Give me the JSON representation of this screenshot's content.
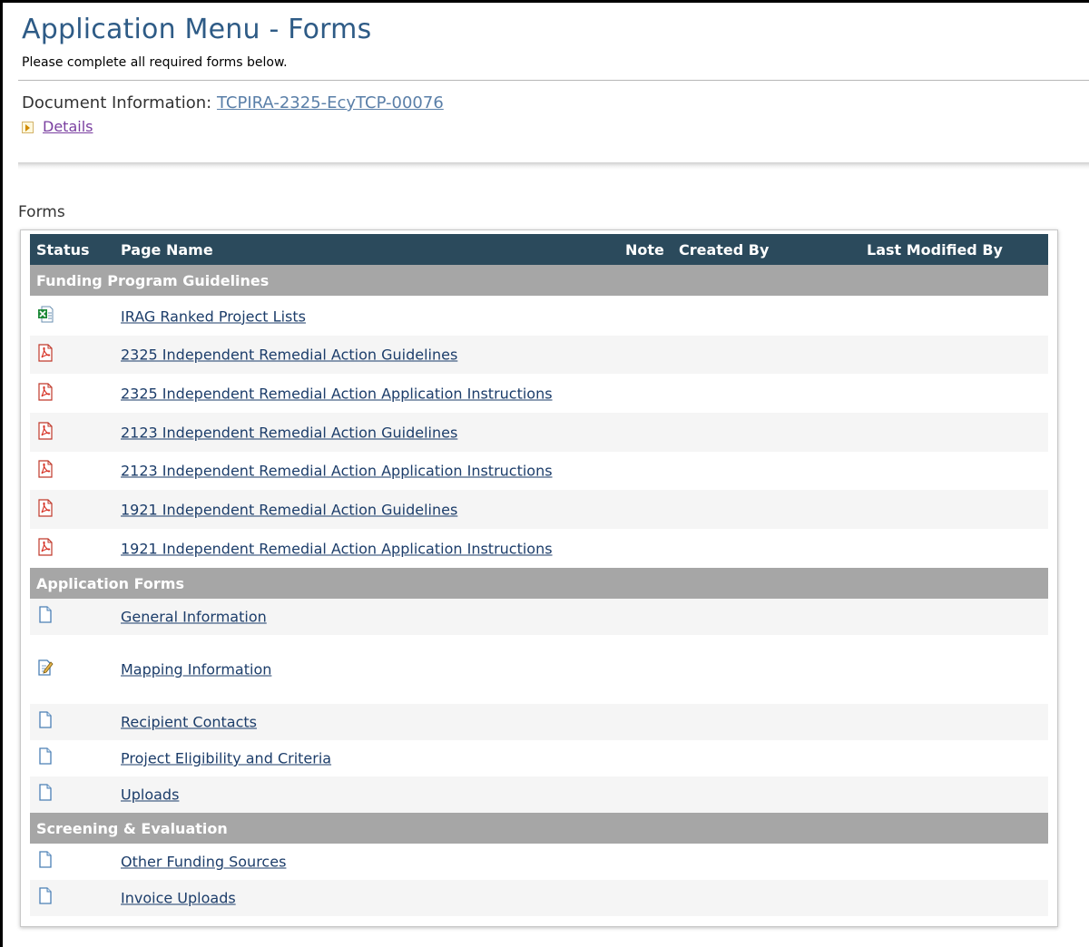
{
  "page": {
    "title": "Application Menu - Forms",
    "subtitle": "Please complete all required forms below.",
    "document_info_label": "Document Information:",
    "document_id": "TCPIRA-2325-EcyTCP-00076",
    "details_link": "Details",
    "forms_label": "Forms"
  },
  "table": {
    "headers": {
      "status": "Status",
      "page_name": "Page Name",
      "note": "Note",
      "created_by": "Created By",
      "last_modified_by": "Last Modified By"
    },
    "groups": {
      "funding": "Funding Program Guidelines",
      "application": "Application Forms",
      "screening": "Screening & Evaluation"
    },
    "rows": [
      {
        "name": "IRAG Ranked Project Lists",
        "icon": "excel-file-icon"
      },
      {
        "name": "2325 Independent Remedial Action Guidelines",
        "icon": "pdf-file-icon"
      },
      {
        "name": "2325 Independent Remedial Action Application Instructions",
        "icon": "pdf-file-icon"
      },
      {
        "name": "2123 Independent Remedial Action Guidelines",
        "icon": "pdf-file-icon"
      },
      {
        "name": "2123 Independent Remedial Action Application Instructions",
        "icon": "pdf-file-icon"
      },
      {
        "name": "1921 Independent Remedial Action Guidelines",
        "icon": "pdf-file-icon"
      },
      {
        "name": "1921 Independent Remedial Action Application Instructions",
        "icon": "pdf-file-icon"
      },
      {
        "name": "General Information",
        "icon": "blank-page-icon"
      },
      {
        "name": "Mapping Information",
        "icon": "edit-page-icon"
      },
      {
        "name": "Recipient Contacts",
        "icon": "blank-page-icon"
      },
      {
        "name": "Project Eligibility and Criteria",
        "icon": "blank-page-icon"
      },
      {
        "name": "Uploads",
        "icon": "blank-page-icon"
      },
      {
        "name": "Other Funding Sources",
        "icon": "blank-page-icon"
      },
      {
        "name": "Invoice Uploads",
        "icon": "blank-page-icon"
      }
    ]
  },
  "colors": {
    "title": "#2e5b86",
    "header_bg": "#2b4a5c",
    "group_bg": "#a6a6a6",
    "link": "#1c3d6a"
  }
}
